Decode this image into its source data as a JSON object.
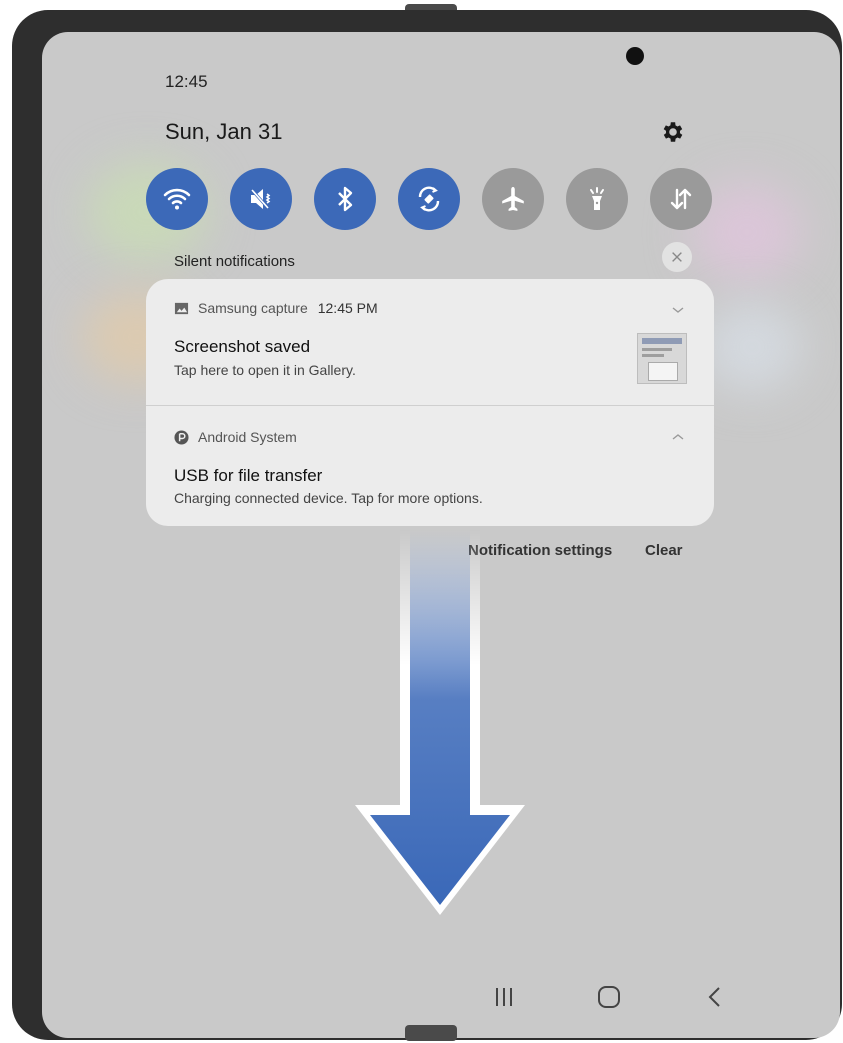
{
  "status_bar": {
    "time": "12:45"
  },
  "header": {
    "date": "Sun, Jan 31"
  },
  "quick_settings": [
    {
      "icon": "wifi-icon",
      "state": "on"
    },
    {
      "icon": "mute-icon",
      "state": "on"
    },
    {
      "icon": "bluetooth-icon",
      "state": "on"
    },
    {
      "icon": "auto-rotate-icon",
      "state": "on"
    },
    {
      "icon": "airplane-mode-icon",
      "state": "off"
    },
    {
      "icon": "flashlight-icon",
      "state": "off"
    },
    {
      "icon": "mobile-data-icon",
      "state": "off"
    }
  ],
  "panel": {
    "section_label": "Silent notifications",
    "notifications": [
      {
        "app": "Samsung capture",
        "time": "12:45 PM",
        "title": "Screenshot saved",
        "text": "Tap here to open it in Gallery."
      },
      {
        "app": "Android System",
        "title": "USB for file transfer",
        "text": "Charging connected device. Tap for more options."
      }
    ],
    "notification_settings_label": "Notification settings",
    "clear_label": "Clear"
  },
  "colors": {
    "accent": "#3c69b8",
    "tile_off": "#9a9a9a",
    "arrow": "#3a68b8"
  }
}
